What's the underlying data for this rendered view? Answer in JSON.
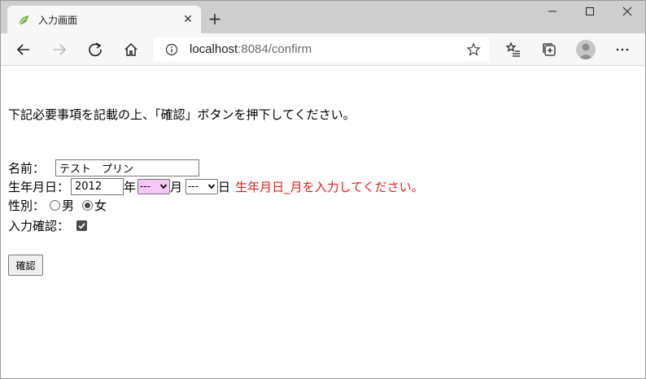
{
  "browser": {
    "tab_title": "入力画面",
    "tab_close_icon": "close-icon",
    "new_tab_icon": "plus-icon",
    "address_host": "localhost",
    "address_rest": ":8084/confirm"
  },
  "page": {
    "instruction": "下記必要事項を記載の上、「確認」ボタンを押下してください。",
    "name_label": "名前：",
    "name_value": "テスト　プリン",
    "birth_label": "生年月日：",
    "year_value": "2012",
    "year_unit": "年",
    "month_value": "---",
    "month_unit": "月",
    "day_value": "---",
    "day_unit": "日",
    "birth_error": "生年月日_月を入力してください。",
    "gender_label": "性別：",
    "gender_options": [
      "男",
      "女"
    ],
    "gender_selected": "女",
    "confirm_label": "入力確認：",
    "confirm_checked": true,
    "submit_label": "確認"
  },
  "colors": {
    "error": "#e0201c",
    "month_select_bg": "#f7c8f7",
    "tabstrip_bg": "#cecece"
  }
}
